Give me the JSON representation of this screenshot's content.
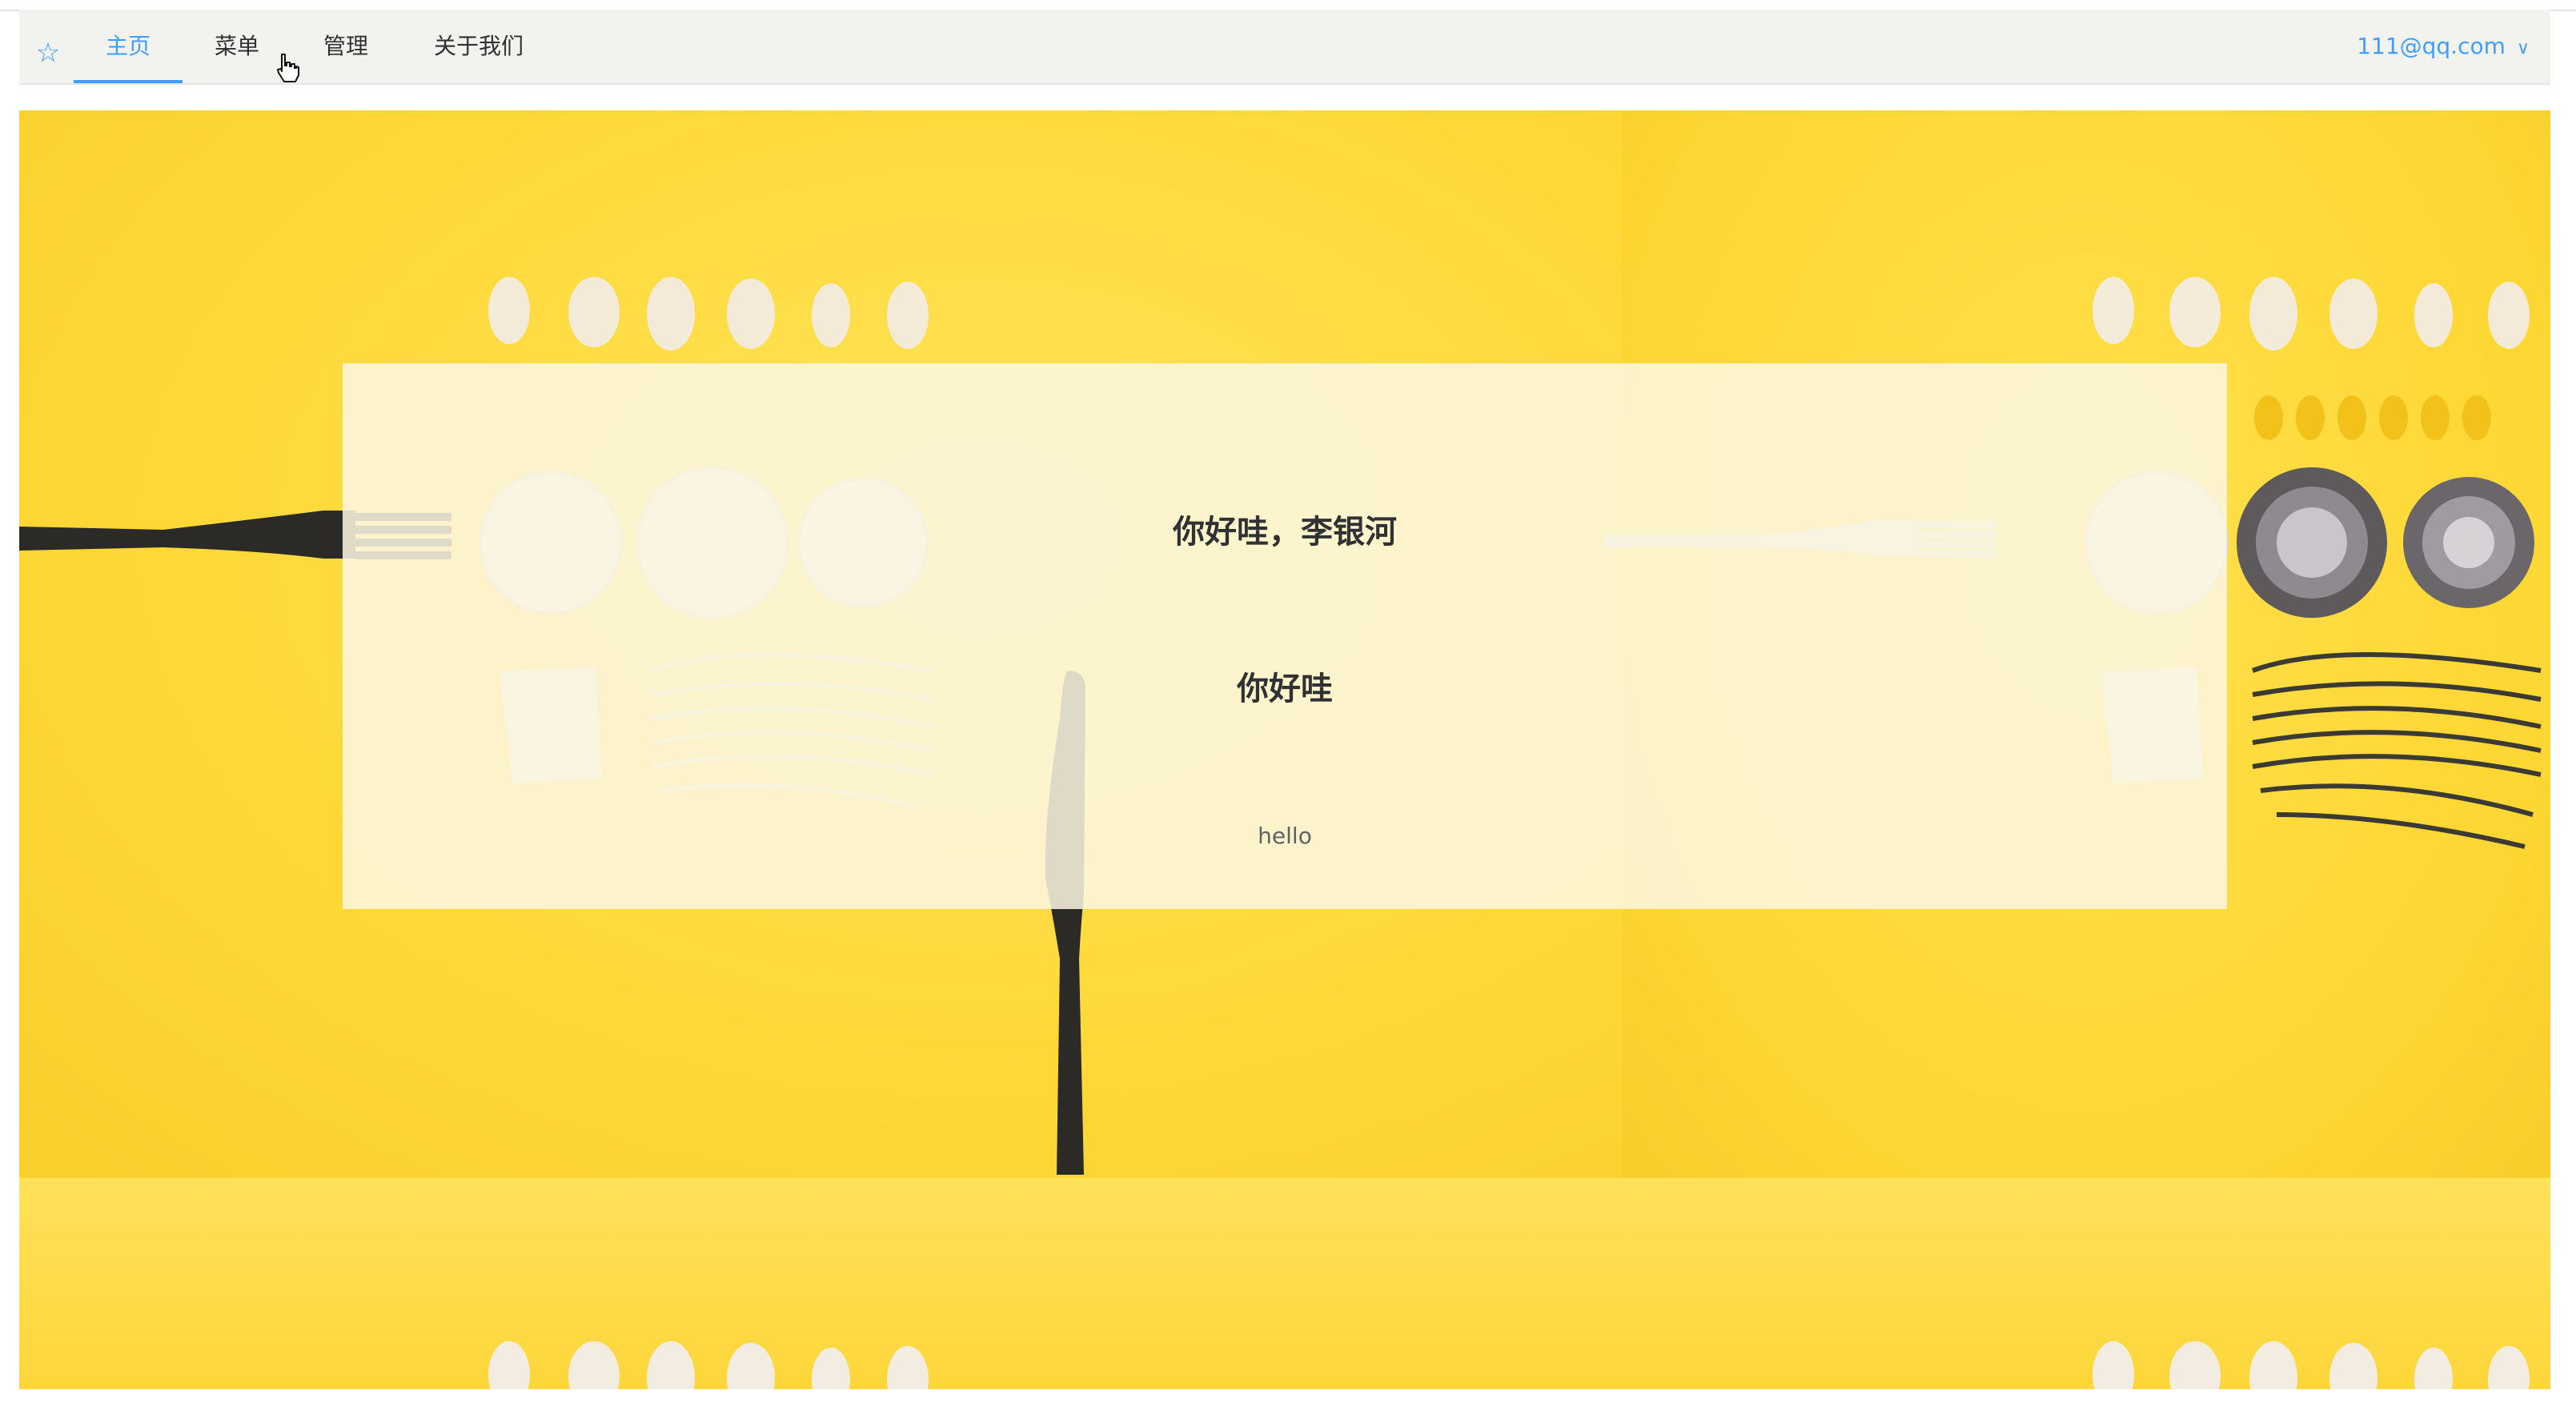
{
  "nav": {
    "items": [
      {
        "label": "主页",
        "active": true
      },
      {
        "label": "菜单",
        "active": false
      },
      {
        "label": "管理",
        "active": false
      },
      {
        "label": "关于我们",
        "active": false
      }
    ],
    "user": "111@qq.com",
    "accent": "#409eff"
  },
  "hero": {
    "title": "你好哇，李银河",
    "subtitle": "你好哇",
    "text": "hello",
    "background_color": "#fdd93a"
  },
  "icons": [
    "star-icon",
    "chevron-down-icon",
    "hand-cursor-icon"
  ]
}
